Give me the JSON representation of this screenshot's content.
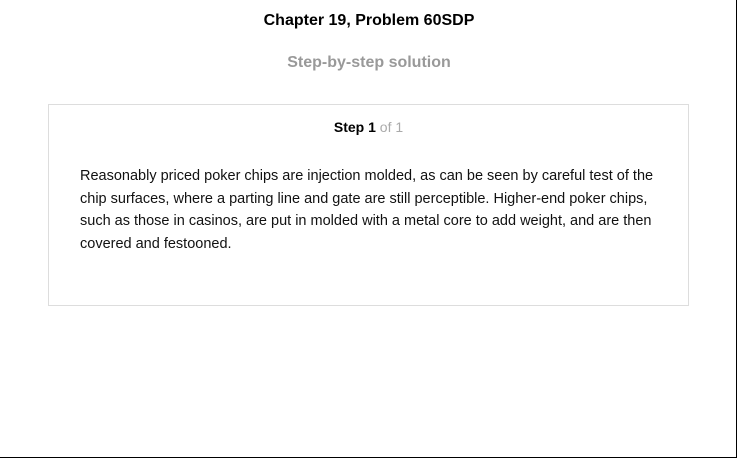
{
  "header": {
    "title": "Chapter 19, Problem 60SDP",
    "subtitle": "Step-by-step solution"
  },
  "step": {
    "label": "Step",
    "number": "1",
    "of_text": "of 1",
    "body": "Reasonably priced poker chips are injection molded, as can be seen by careful test of the chip surfaces, where a parting line and gate are still perceptible. Higher-end poker chips, such as those in casinos, are put in molded with a metal core to add weight, and are then covered and festooned."
  }
}
